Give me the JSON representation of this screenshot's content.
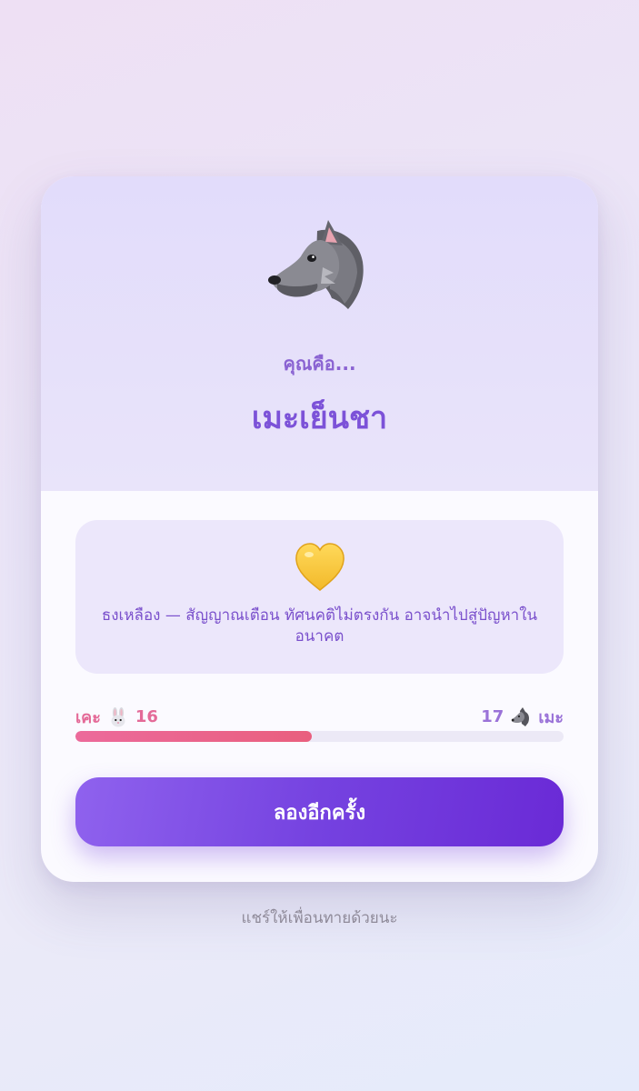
{
  "result": {
    "animal_icon": "wolf-icon",
    "subtitle": "คุณคือ...",
    "title": "เมะเย็นชา"
  },
  "info": {
    "icon": "yellow-heart-icon",
    "text": "ธงเหลือง — สัญญาณเตือน ทัศนคติไม่ตรงกัน อาจนำไปสู่ปัญหาในอนาคต"
  },
  "scores": {
    "left_label": "เคะ",
    "left_icon": "rabbit-icon",
    "left_value": "16",
    "right_value": "17",
    "right_icon": "wolf-icon",
    "right_label": "เมะ",
    "left_fraction": 0.485,
    "left_color": "#e96a93",
    "right_color": "#9a72d8"
  },
  "actions": {
    "retry_label": "ลองอีกครั้ง"
  },
  "footer": {
    "share_text": "แชร์ให้เพื่อนทายด้วยนะ"
  },
  "colors": {
    "accent": "#7c52d8",
    "button_start": "#8f62ee",
    "button_end": "#6a2ad6"
  }
}
